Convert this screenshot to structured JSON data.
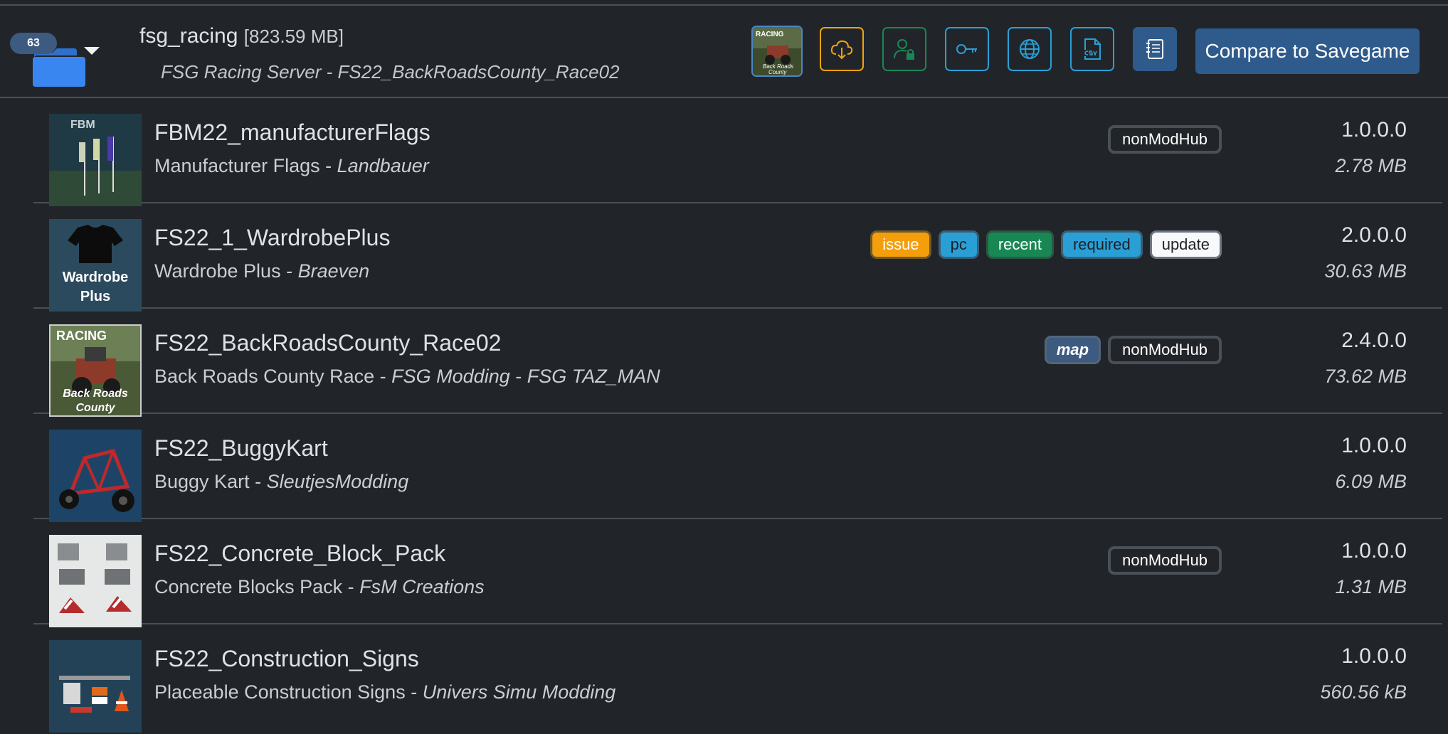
{
  "collection": {
    "count": "63",
    "name": "fsg_racing",
    "size": "[823.59 MB]",
    "description": "FSG Racing Server - FS22_BackRoadsCounty_Race02",
    "compare_label": "Compare to Savegame",
    "icon_buttons": [
      {
        "icon": "cloud-download-icon",
        "color": "#f0a30a"
      },
      {
        "icon": "user-lock-icon",
        "color": "#198754"
      },
      {
        "icon": "key-icon",
        "color": "#2a9fd6"
      },
      {
        "icon": "globe-icon",
        "color": "#2a9fd6"
      },
      {
        "icon": "csv-file-icon",
        "color": "#2a9fd6"
      },
      {
        "icon": "notebook-icon",
        "color": "#ffffff"
      }
    ],
    "thumb_text": [
      "RACING",
      "Back Roads",
      "County"
    ]
  },
  "mods": [
    {
      "name": "FBM22_manufacturerFlags",
      "title": "Manufacturer Flags",
      "authors": [
        "Landbauer"
      ],
      "version": "1.0.0.0",
      "size": "2.78 MB",
      "badges": [
        "nonModHub"
      ],
      "thumb": "flags",
      "thumb_text": [
        "FBM"
      ]
    },
    {
      "name": "FS22_1_WardrobePlus",
      "title": "Wardrobe Plus",
      "authors": [
        "Braeven"
      ],
      "version": "2.0.0.0",
      "size": "30.63 MB",
      "badges": [
        "issue",
        "pc",
        "recent",
        "required",
        "update"
      ],
      "thumb": "wardrobe",
      "thumb_text": [
        "Wardrobe",
        "Plus"
      ]
    },
    {
      "name": "FS22_BackRoadsCounty_Race02",
      "title": "Back Roads County Race",
      "authors": [
        "FSG Modding",
        "FSG TAZ_MAN"
      ],
      "version": "2.4.0.0",
      "size": "73.62 MB",
      "badges": [
        "map",
        "nonModHub"
      ],
      "thumb": "racing",
      "thumb_text": [
        "RACING",
        "Back Roads",
        "County"
      ]
    },
    {
      "name": "FS22_BuggyKart",
      "title": "Buggy Kart",
      "authors": [
        "SleutjesModding"
      ],
      "version": "1.0.0.0",
      "size": "6.09 MB",
      "badges": [],
      "thumb": "buggy",
      "thumb_text": []
    },
    {
      "name": "FS22_Concrete_Block_Pack",
      "title": "Concrete Blocks Pack",
      "authors": [
        "FsM Creations"
      ],
      "version": "1.0.0.0",
      "size": "1.31 MB",
      "badges": [
        "nonModHub"
      ],
      "thumb": "concrete",
      "thumb_text": []
    },
    {
      "name": "FS22_Construction_Signs",
      "title": "Placeable Construction Signs",
      "authors": [
        "Univers Simu Modding"
      ],
      "version": "1.0.0.0",
      "size": "560.56 kB",
      "badges": [],
      "thumb": "signs",
      "thumb_text": []
    }
  ]
}
